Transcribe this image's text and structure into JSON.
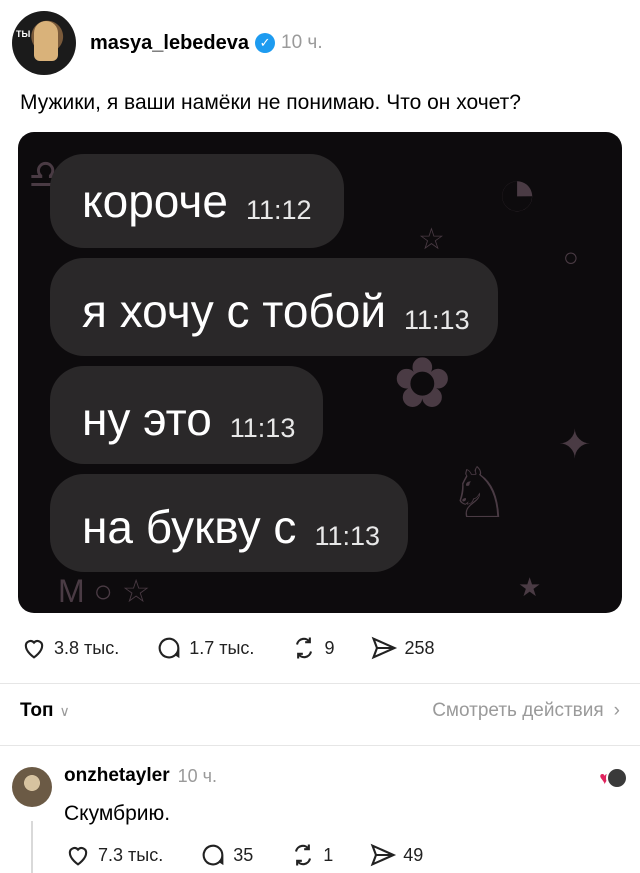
{
  "post": {
    "username": "masya_lebedeva",
    "time": "10 ч.",
    "text": "Мужики, я ваши намёки не понимаю. Что он хочет?",
    "avatar_tag": "ТЫ",
    "messages": [
      {
        "text": "короче",
        "time": "11:12"
      },
      {
        "text": "я хочу с тобой",
        "time": "11:13"
      },
      {
        "text": "ну это",
        "time": "11:13"
      },
      {
        "text": "на букву с",
        "time": "11:13"
      }
    ],
    "actions": {
      "likes": "3.8 тыс.",
      "comments": "1.7 тыс.",
      "reposts": "9",
      "shares": "258"
    }
  },
  "sort": {
    "label": "Топ",
    "view_actions": "Смотреть действия"
  },
  "comment": {
    "username": "onzhetayler",
    "time": "10 ч.",
    "text": "Скумбрию.",
    "actions": {
      "likes": "7.3 тыс.",
      "comments": "35",
      "reposts": "1",
      "shares": "49"
    }
  },
  "colors": {
    "verified": "#1d9bf0",
    "bubble": "#2a2829",
    "image_bg": "#0d0b0d",
    "muted": "#9a9a9a"
  }
}
